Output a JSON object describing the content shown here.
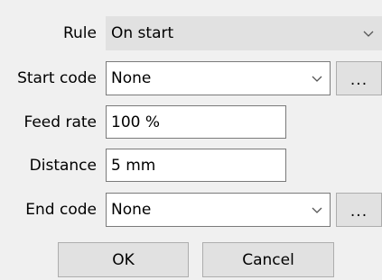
{
  "labels": {
    "rule": "Rule",
    "start_code": "Start code",
    "feed_rate": "Feed rate",
    "distance": "Distance",
    "end_code": "End code"
  },
  "fields": {
    "rule_value": "On start",
    "start_code_value": "None",
    "feed_rate_value": "100 %",
    "distance_value": "5 mm",
    "end_code_value": "None"
  },
  "buttons": {
    "browse": "...",
    "ok": "OK",
    "cancel": "Cancel"
  },
  "icons": {
    "dropdown": "chevron-down-icon"
  }
}
